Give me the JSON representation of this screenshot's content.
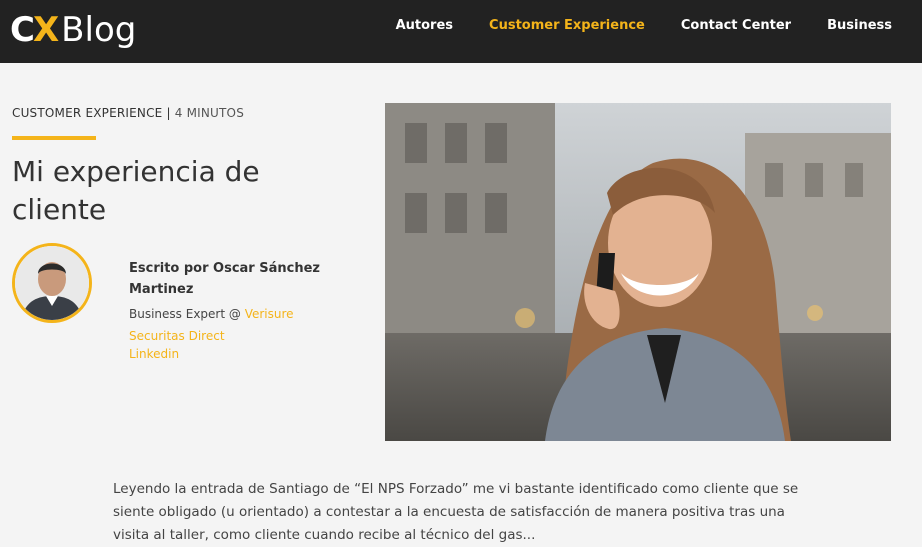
{
  "header": {
    "logo_cx_c": "C",
    "logo_cx_x": "X",
    "logo_blog": "Blog",
    "nav": [
      {
        "label": "Autores",
        "active": false
      },
      {
        "label": "Customer Experience",
        "active": true
      },
      {
        "label": "Contact Center",
        "active": false
      },
      {
        "label": "Business",
        "active": false
      }
    ]
  },
  "article": {
    "category": "CUSTOMER EXPERIENCE",
    "separator": "|",
    "read_time": "4 MINUTOS",
    "title": "Mi experiencia de cliente",
    "author": {
      "byline": "Escrito por Oscar Sánchez Martinez",
      "role_prefix": "Business Expert @ ",
      "company": "Verisure Securitas Direct",
      "linkedin": "Linkedin"
    },
    "excerpt": "Leyendo la entrada de Santiago de “El NPS Forzado” me vi bastante identificado como cliente que se siente obligado (u orientado) a contestar a la encuesta de satisfacción de manera positiva tras una visita al taller, como cliente cuando recibe al técnico del gas..."
  },
  "colors": {
    "accent": "#f4b41a",
    "topbar": "#222222",
    "background": "#f4f4f4"
  }
}
